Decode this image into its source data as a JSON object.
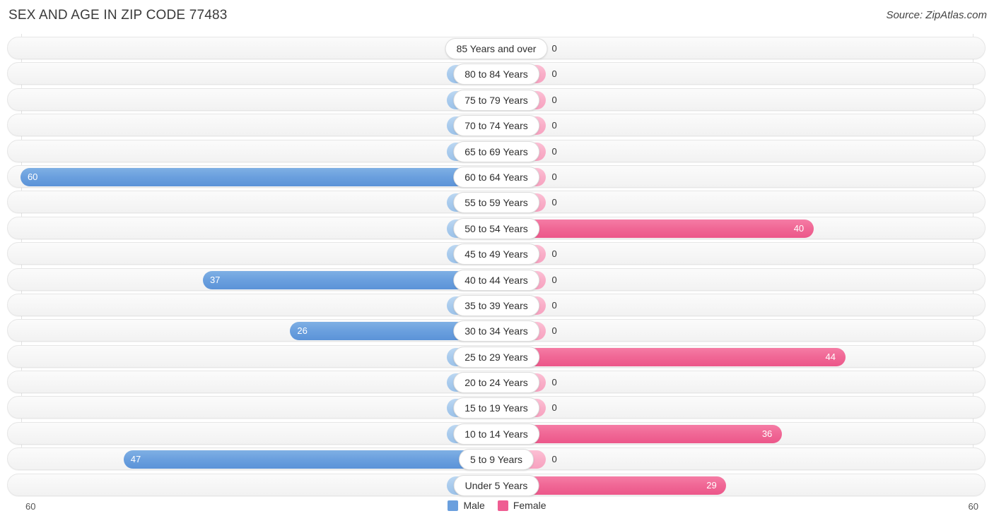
{
  "header": {
    "title": "SEX AND AGE IN ZIP CODE 77483",
    "source": "Source: ZipAtlas.com"
  },
  "legend": {
    "male_label": "Male",
    "female_label": "Female",
    "male_color": "#6a9fde",
    "female_color": "#ef5d92"
  },
  "axis": {
    "left_label": "60",
    "right_label": "60",
    "max": 60
  },
  "chart_data": {
    "type": "bar",
    "title": "SEX AND AGE IN ZIP CODE 77483",
    "subtitle": "Source: ZipAtlas.com",
    "orientation": "horizontal-diverging",
    "xlabel": "",
    "ylabel": "",
    "xlim": [
      60,
      60
    ],
    "grid": true,
    "legend_position": "bottom-center",
    "categories": [
      "85 Years and over",
      "80 to 84 Years",
      "75 to 79 Years",
      "70 to 74 Years",
      "65 to 69 Years",
      "60 to 64 Years",
      "55 to 59 Years",
      "50 to 54 Years",
      "45 to 49 Years",
      "40 to 44 Years",
      "35 to 39 Years",
      "30 to 34 Years",
      "25 to 29 Years",
      "20 to 24 Years",
      "15 to 19 Years",
      "10 to 14 Years",
      "5 to 9 Years",
      "Under 5 Years"
    ],
    "series": [
      {
        "name": "Male",
        "color": "#6a9fde",
        "values": [
          0,
          0,
          0,
          0,
          0,
          60,
          0,
          0,
          0,
          37,
          0,
          26,
          0,
          0,
          0,
          0,
          47,
          0
        ]
      },
      {
        "name": "Female",
        "color": "#ef5d92",
        "values": [
          0,
          0,
          0,
          0,
          0,
          0,
          0,
          40,
          0,
          0,
          0,
          0,
          44,
          0,
          0,
          36,
          0,
          29
        ]
      }
    ]
  },
  "rows": [
    {
      "label": "85 Years and over",
      "male": "0",
      "female": "0"
    },
    {
      "label": "80 to 84 Years",
      "male": "0",
      "female": "0"
    },
    {
      "label": "75 to 79 Years",
      "male": "0",
      "female": "0"
    },
    {
      "label": "70 to 74 Years",
      "male": "0",
      "female": "0"
    },
    {
      "label": "65 to 69 Years",
      "male": "0",
      "female": "0"
    },
    {
      "label": "60 to 64 Years",
      "male": "60",
      "female": "0"
    },
    {
      "label": "55 to 59 Years",
      "male": "0",
      "female": "0"
    },
    {
      "label": "50 to 54 Years",
      "male": "0",
      "female": "40"
    },
    {
      "label": "45 to 49 Years",
      "male": "0",
      "female": "0"
    },
    {
      "label": "40 to 44 Years",
      "male": "37",
      "female": "0"
    },
    {
      "label": "35 to 39 Years",
      "male": "0",
      "female": "0"
    },
    {
      "label": "30 to 34 Years",
      "male": "26",
      "female": "0"
    },
    {
      "label": "25 to 29 Years",
      "male": "0",
      "female": "44"
    },
    {
      "label": "20 to 24 Years",
      "male": "0",
      "female": "0"
    },
    {
      "label": "15 to 19 Years",
      "male": "0",
      "female": "0"
    },
    {
      "label": "10 to 14 Years",
      "male": "0",
      "female": "36"
    },
    {
      "label": "5 to 9 Years",
      "male": "47",
      "female": "0"
    },
    {
      "label": "Under 5 Years",
      "male": "0",
      "female": "29"
    }
  ]
}
